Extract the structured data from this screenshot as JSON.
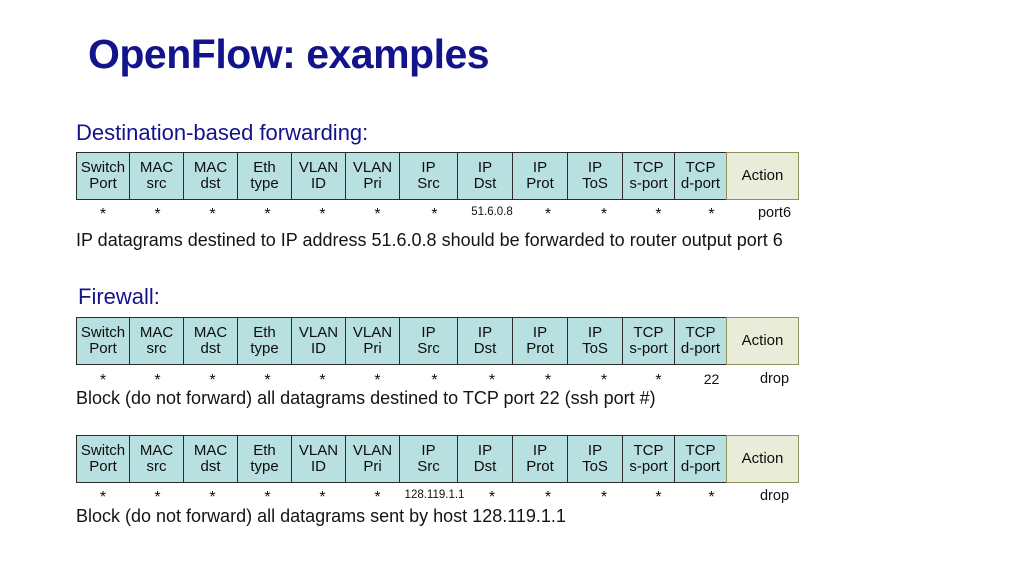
{
  "slide": {
    "title": "OpenFlow: examples"
  },
  "columns": [
    {
      "line1": "Switch",
      "line2": "Port",
      "width": 54
    },
    {
      "line1": "MAC",
      "line2": "src",
      "width": 55
    },
    {
      "line1": "MAC",
      "line2": "dst",
      "width": 55
    },
    {
      "line1": "Eth",
      "line2": "type",
      "width": 55
    },
    {
      "line1": "VLAN",
      "line2": "ID",
      "width": 55
    },
    {
      "line1": "VLAN",
      "line2": "Pri",
      "width": 55
    },
    {
      "line1": "IP",
      "line2": "Src",
      "width": 59
    },
    {
      "line1": "IP",
      "line2": "Dst",
      "width": 56
    },
    {
      "line1": "IP",
      "line2": "Prot",
      "width": 56
    },
    {
      "line1": "IP",
      "line2": "ToS",
      "width": 56
    },
    {
      "line1": "TCP",
      "line2": "s-port",
      "width": 53
    },
    {
      "line1": "TCP",
      "line2": "d-port",
      "width": 53
    },
    {
      "line1": "Action",
      "line2": "",
      "width": 73
    }
  ],
  "sections": [
    {
      "heading": "Destination-based forwarding:",
      "values": [
        "*",
        "*",
        "*",
        "*",
        "*",
        "*",
        "*",
        "51.6.0.8",
        "*",
        "*",
        "*",
        "*",
        "port6"
      ],
      "caption": "IP datagrams destined to IP address  51.6.0.8 should be forwarded to router output port 6"
    },
    {
      "heading": "Firewall:",
      "values": [
        "*",
        "*",
        "*",
        "*",
        "*",
        "*",
        "*",
        "*",
        "*",
        "*",
        "*",
        "22",
        "drop"
      ],
      "caption": "Block (do not forward) all datagrams destined to TCP  port 22 (ssh port #)"
    },
    {
      "heading": "",
      "values": [
        "*",
        "*",
        "*",
        "*",
        "*",
        "*",
        "128.119.1.1",
        "*",
        "*",
        "*",
        "*",
        "*",
        "drop"
      ],
      "caption": "Block (do not forward) all datagrams sent by host 128.119.1.1"
    }
  ],
  "colors": {
    "header_cell": "#b9e0e0",
    "action_cell": "#e8ecd8",
    "title_blue": "#13138c",
    "text_black": "#111111"
  }
}
